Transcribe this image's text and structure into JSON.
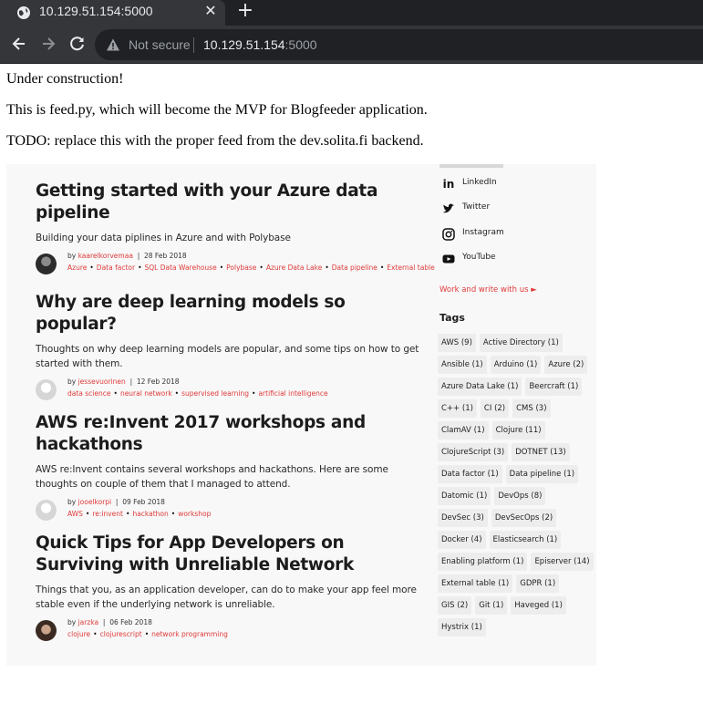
{
  "browser": {
    "tab_title": "10.129.51.154:5000",
    "security_label": "Not secure",
    "url_host": "10.129.51.154",
    "url_port": ":5000"
  },
  "page": {
    "paragraphs": [
      "Under construction!",
      "This is feed.py, which will become the MVP for Blogfeeder application.",
      "TODO: replace this with the proper feed from the dev.solita.fi backend."
    ]
  },
  "blog_image": {
    "posts": [
      {
        "title": "Getting started with your Azure data pipeline",
        "description": "Building your data piplines in Azure and with Polybase",
        "author": "kaarelkorvemaa",
        "date": "28 Feb 2018",
        "tags": [
          "Azure",
          "Data factor",
          "SQL Data Warehouse",
          "Polybase",
          "Azure Data Lake",
          "Data pipeline",
          "External table"
        ]
      },
      {
        "title": "Why are deep learning models so popular?",
        "description": "Thoughts on why deep learning models are popular, and some tips on how to get started with them.",
        "author": "jessevuorinen",
        "date": "12 Feb 2018",
        "tags": [
          "data science",
          "neural network",
          "supervised learning",
          "artificial intelligence"
        ]
      },
      {
        "title": "AWS re:Invent 2017 workshops and hackathons",
        "description": "AWS re:Invent contains several workshops and hackathons. Here are some thoughts on couple of them that I managed to attend.",
        "author": "jooelkorpi",
        "date": "09 Feb 2018",
        "tags": [
          "AWS",
          "re:invent",
          "hackathon",
          "workshop"
        ]
      },
      {
        "title": "Quick Tips for App Developers on Surviving with Unreliable Network",
        "description": "Things that you, as an application developer, can do to make your app feel more stable even if the underlying network is unreliable.",
        "author": "jarzka",
        "date": "06 Feb 2018",
        "tags": [
          "clojure",
          "clojurescript",
          "network programming"
        ]
      }
    ],
    "by_label": "by",
    "sidebar": {
      "social": [
        {
          "label": "LinkedIn",
          "icon": "linkedin-icon"
        },
        {
          "label": "Twitter",
          "icon": "twitter-icon"
        },
        {
          "label": "Instagram",
          "icon": "instagram-icon"
        },
        {
          "label": "YouTube",
          "icon": "youtube-icon"
        }
      ],
      "work_link": "Work and write with us",
      "tags_heading": "Tags",
      "tags": [
        "AWS (9)",
        "Active Directory (1)",
        "Ansible (1)",
        "Arduino (1)",
        "Azure (2)",
        "Azure Data Lake (1)",
        "Beercraft (1)",
        "C++ (1)",
        "CI (2)",
        "CMS (3)",
        "ClamAV (1)",
        "Clojure (11)",
        "ClojureScript (3)",
        "DOTNET (13)",
        "Data factor (1)",
        "Data pipeline (1)",
        "Datomic (1)",
        "DevOps (8)",
        "DevSec (3)",
        "DevSecOps (2)",
        "Docker (4)",
        "Elasticsearch (1)",
        "Enabling platform (1)",
        "Episerver (14)",
        "External table (1)",
        "GDPR (1)",
        "GIS (2)",
        "Git (1)",
        "Haveged (1)",
        "Hystrix (1)"
      ]
    }
  }
}
